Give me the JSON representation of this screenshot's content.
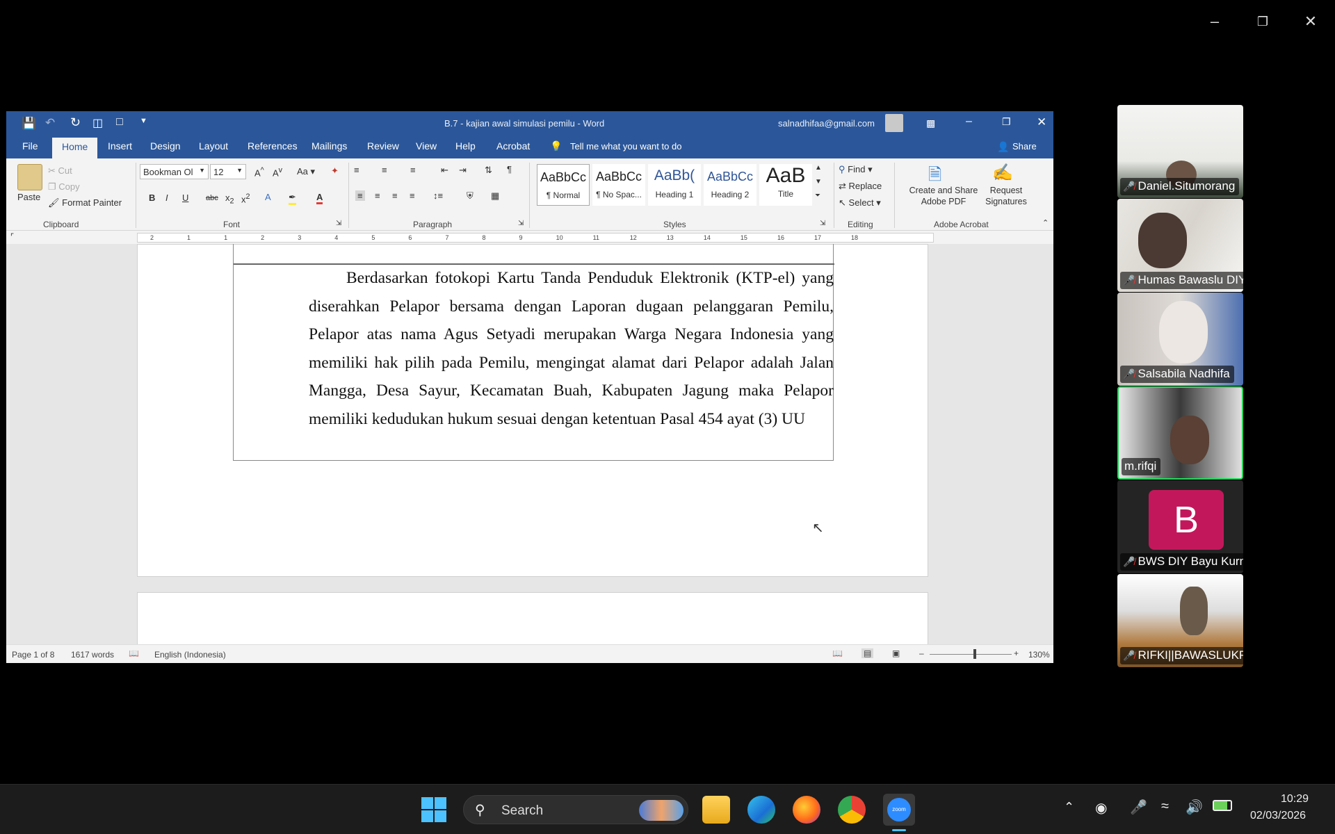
{
  "word": {
    "title": "B.7 - kajian awal simulasi pemilu  -  Word",
    "account": "salnadhifaa@gmail.com",
    "tabs": [
      "File",
      "Home",
      "Insert",
      "Design",
      "Layout",
      "References",
      "Mailings",
      "Review",
      "View",
      "Help",
      "Acrobat"
    ],
    "tell_me": "Tell me what you want to do",
    "share": "Share",
    "clipboard": {
      "paste": "Paste",
      "cut": "Cut",
      "copy": "Copy",
      "format_painter": "Format Painter",
      "label": "Clipboard"
    },
    "font": {
      "name": "Bookman Ol",
      "size": "12",
      "label": "Font",
      "case": "Aa"
    },
    "paragraph_label": "Paragraph",
    "styles": [
      {
        "preview": "AaBbCc",
        "name": "¶ Normal"
      },
      {
        "preview": "AaBbCc",
        "name": "¶ No Spac..."
      },
      {
        "preview": "AaBb(",
        "name": "Heading 1"
      },
      {
        "preview": "AaBbCc",
        "name": "Heading 2"
      },
      {
        "preview": "AaB",
        "name": "Title"
      }
    ],
    "styles_label": "Styles",
    "editing": {
      "find": "Find",
      "replace": "Replace",
      "select": "Select",
      "label": "Editing"
    },
    "acrobat": {
      "create": "Create and Share Adobe PDF",
      "request": "Request Signatures",
      "label": "Adobe Acrobat"
    },
    "ruler_numbers": [
      "2",
      "1",
      "1",
      "2",
      "3",
      "4",
      "5",
      "6",
      "7",
      "8",
      "9",
      "10",
      "11",
      "12",
      "13",
      "14",
      "15",
      "16",
      "17",
      "18"
    ],
    "document_text": "Berdasarkan fotokopi Kartu Tanda Penduduk Elektronik (KTP-el) yang diserahkan Pelapor bersama dengan Laporan dugaan pelanggaran Pemilu, Pelapor atas nama Agus Setyadi merupakan Warga Negara Indonesia yang memiliki hak pilih pada Pemilu, mengingat alamat dari Pelapor adalah Jalan Mangga, Desa Sayur, Kecamatan Buah, Kabupaten Jagung maka Pelapor memiliki kedudukan hukum sesuai dengan ketentuan Pasal 454 ayat (3) UU",
    "status": {
      "page": "Page 1 of 8",
      "words": "1617 words",
      "language": "English (Indonesia)",
      "zoom": "130%"
    },
    "zoom_level": 1.3
  },
  "zoom": {
    "participants": [
      {
        "name": "Daniel.Situmorang",
        "muted": true,
        "active": false
      },
      {
        "name": "Humas Bawaslu DIY",
        "muted": true,
        "active": false
      },
      {
        "name": "Salsabila Nadhifa",
        "muted": true,
        "active": false
      },
      {
        "name": "m.rifqi",
        "muted": false,
        "active": true
      },
      {
        "name": "BWS DIY Bayu Kurnia...",
        "muted": true,
        "active": false,
        "initial": "B"
      },
      {
        "name": "RIFKI||BAWASLUKP",
        "muted": true,
        "active": false
      }
    ]
  },
  "taskbar": {
    "search_placeholder": "Search",
    "time": "10:29",
    "date": "02/03/2026"
  },
  "colors": {
    "word_blue": "#2b579a",
    "zoom_active": "#23d959",
    "avatar_pink": "#c2185b",
    "taskbar": "#1c1c1c"
  }
}
